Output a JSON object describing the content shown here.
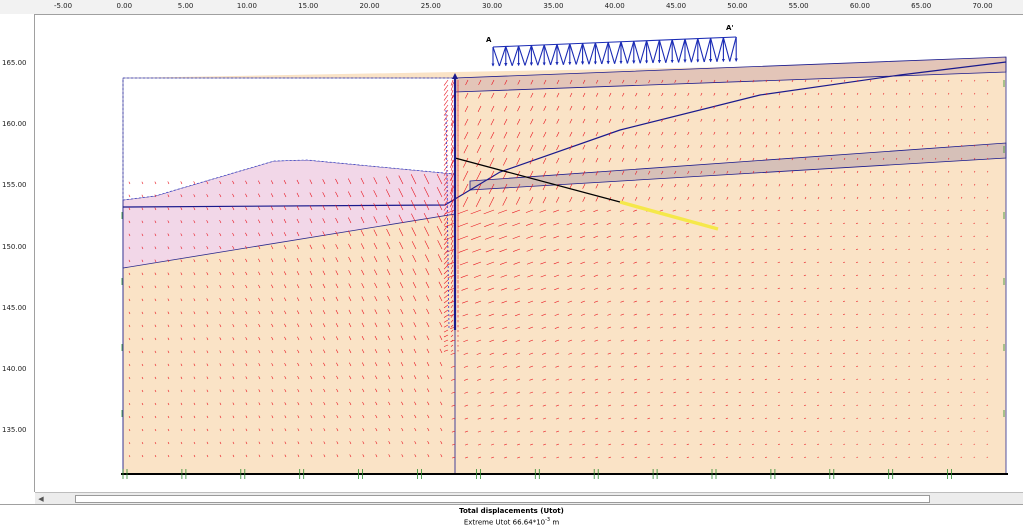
{
  "rulers": {
    "x_labels": [
      "-5.00",
      "0.00",
      "5.00",
      "10.00",
      "15.00",
      "20.00",
      "25.00",
      "30.00",
      "35.00",
      "40.00",
      "45.00",
      "50.00",
      "55.00",
      "60.00",
      "65.00",
      "70.00"
    ],
    "y_labels": [
      "165.00",
      "160.00",
      "155.00",
      "150.00",
      "145.00",
      "140.00",
      "135.00"
    ]
  },
  "model": {
    "point_a_label": "A",
    "point_a2_label": "A'"
  },
  "status": {
    "title": "Total displacements (Utot)",
    "extreme_prefix": "Extreme Utot 66.64*10",
    "extreme_exp": "-3",
    "extreme_unit": " m"
  },
  "colors": {
    "soil_main": "#fae3c6",
    "soil_pink": "#f2d7e8",
    "soil_layer": "#e3c5b8",
    "wall": "#1a1a8c",
    "vectors": "#e8141e",
    "anchor_grout": "#f5e84a",
    "load": "#1a2bb5"
  }
}
